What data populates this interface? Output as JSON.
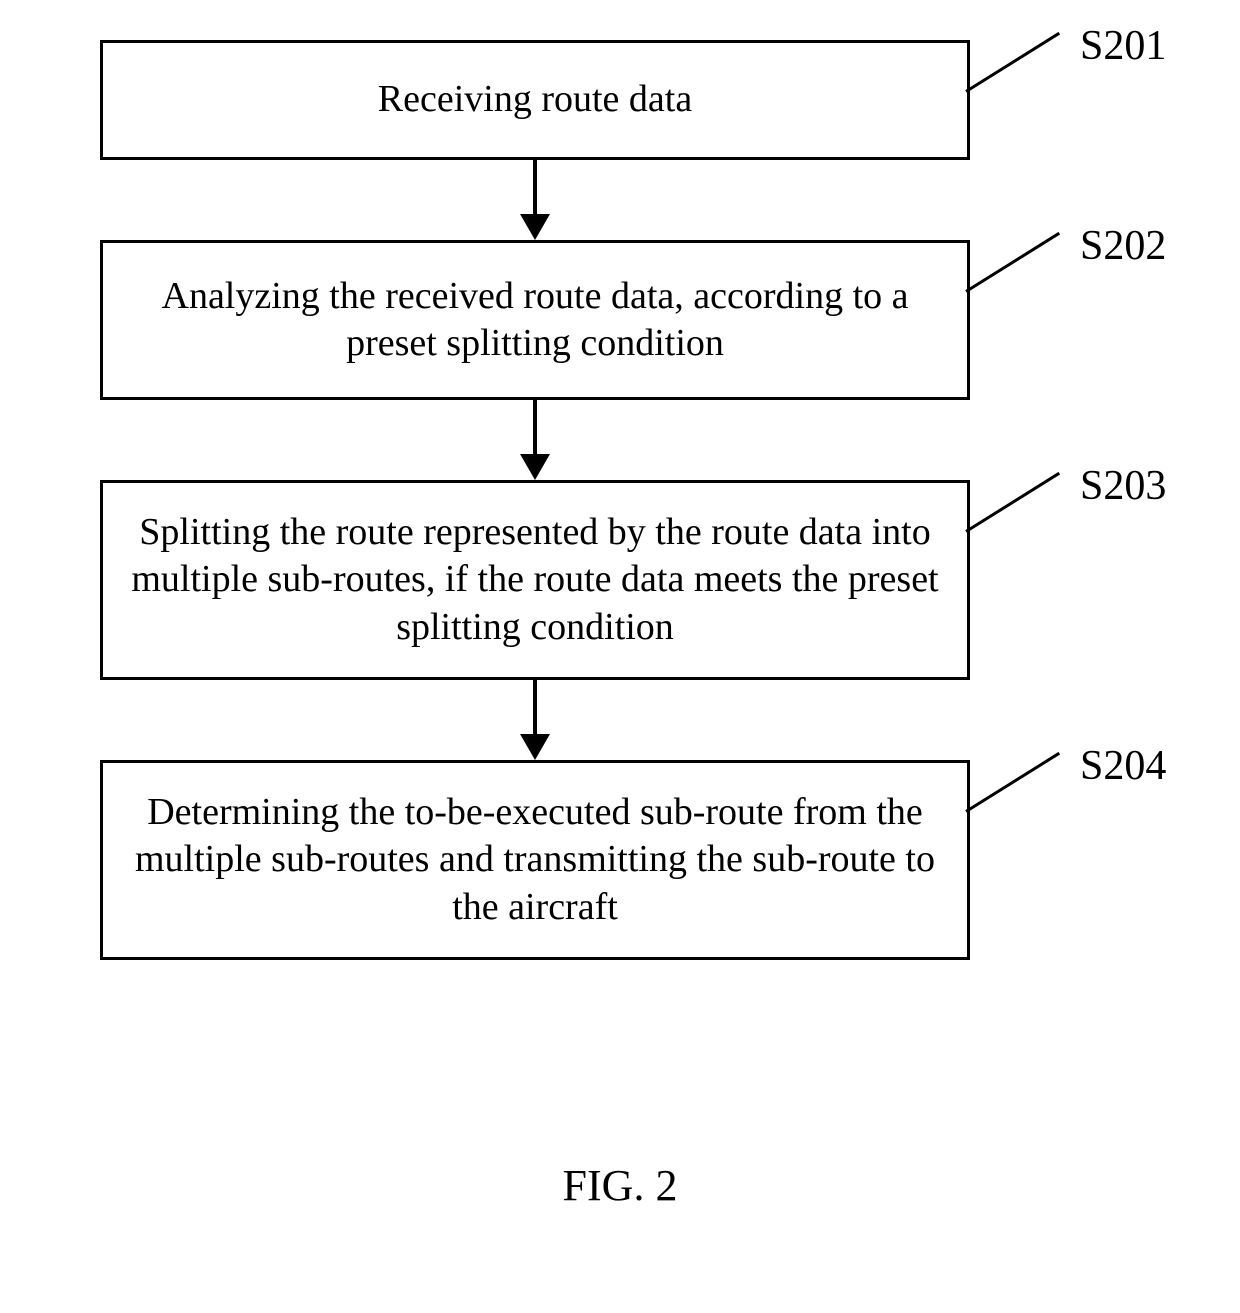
{
  "flow": {
    "steps": [
      {
        "label": "S201",
        "text": "Receiving route data"
      },
      {
        "label": "S202",
        "text": "Analyzing the received route data, according to a preset splitting condition"
      },
      {
        "label": "S203",
        "text": "Splitting the route represented by the route data into multiple sub-routes, if the route data meets the preset splitting condition"
      },
      {
        "label": "S204",
        "text": "Determining the to-be-executed sub-route from the multiple sub-routes and transmitting the sub-route to the aircraft"
      }
    ]
  },
  "caption": "FIG. 2"
}
